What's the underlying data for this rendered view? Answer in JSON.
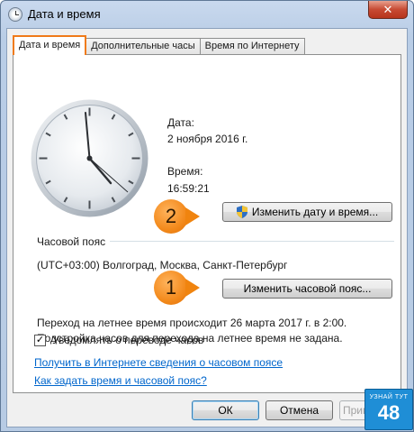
{
  "window": {
    "title": "Дата и время",
    "close_label": "✕"
  },
  "tabs": [
    {
      "label": "Дата и время",
      "active": true
    },
    {
      "label": "Дополнительные часы",
      "active": false
    },
    {
      "label": "Время по Интернету",
      "active": false
    }
  ],
  "datetime": {
    "date_label": "Дата:",
    "date_value": "2 ноября 2016 г.",
    "time_label": "Время:",
    "time_value": "16:59:21",
    "change_datetime_button": "Изменить дату и время..."
  },
  "timezone": {
    "section_label": "Часовой пояс",
    "value": "(UTC+03:00) Волгоград, Москва, Санкт-Петербург",
    "change_timezone_button": "Изменить часовой пояс..."
  },
  "dst": {
    "line1": "Переход на летнее время происходит 26 марта 2017 г. в 2:00.",
    "line2": "Подстройка часов для перехода на летнее время не задана."
  },
  "notify_checkbox": {
    "label": "Уведомлять о переводе часов",
    "checked": true,
    "mark": "✓"
  },
  "links": {
    "timezone_info": "Получить в Интернете сведения о часовом поясе",
    "how_to_set": "Как задать время и часовой пояс?"
  },
  "footer": {
    "ok_button": "ОК",
    "cancel_button": "Отмена",
    "apply_button": "Применить"
  },
  "annotations": {
    "marker_1": "1",
    "marker_2": "2"
  },
  "watermark": {
    "top_text": "УЗНАЙ ТУТ",
    "number": "48"
  },
  "colors": {
    "tab_highlight": "#f07b1a",
    "marker": "#f38a1c",
    "link": "#0066cc",
    "watermark_bg": "#1f8ed6"
  }
}
